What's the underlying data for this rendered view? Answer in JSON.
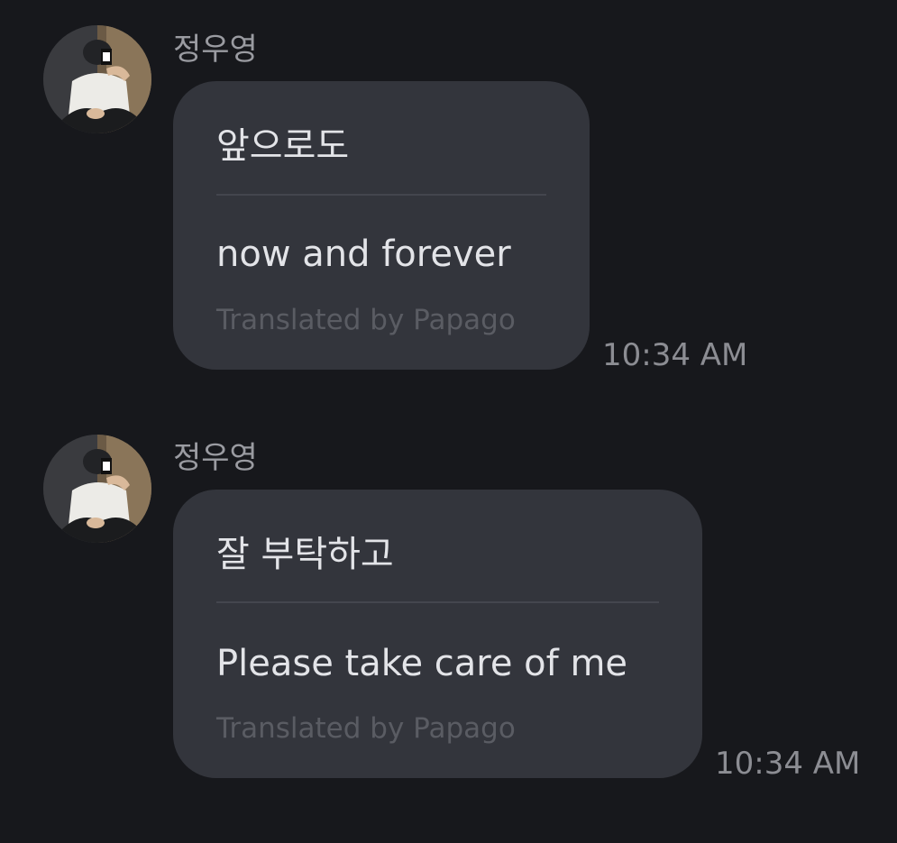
{
  "messages": [
    {
      "sender": "정우영",
      "avatar_icon": "user-photo-avatar",
      "original": "앞으로도",
      "translation": "now and forever",
      "credit": "Translated by Papago",
      "time": "10:34 AM"
    },
    {
      "sender": "정우영",
      "avatar_icon": "user-photo-avatar",
      "original": "잘 부탁하고",
      "translation": "Please take care of me",
      "credit": "Translated by Papago",
      "time": "10:34 AM"
    }
  ],
  "colors": {
    "background": "#17181c",
    "bubble": "#33353c",
    "text": "#e3e4e8",
    "muted": "#5a5c63",
    "timestamp": "#8c8d93"
  }
}
